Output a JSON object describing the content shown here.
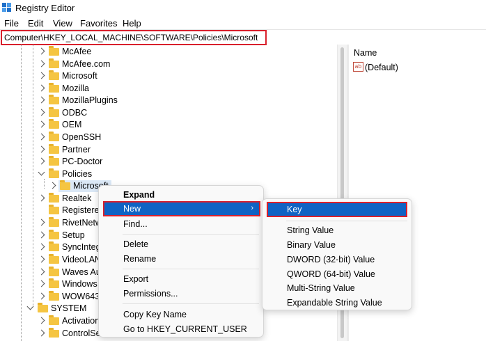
{
  "window": {
    "title": "Registry Editor",
    "icon": "registry-icon"
  },
  "menu": [
    "File",
    "Edit",
    "View",
    "Favorites",
    "Help"
  ],
  "address": {
    "path": "Computer\\HKEY_LOCAL_MACHINE\\SOFTWARE\\Policies\\Microsoft",
    "highlight_color": "#d9202c"
  },
  "tree": {
    "top_items": [
      "McAfee",
      "McAfee.com",
      "Microsoft",
      "Mozilla",
      "MozillaPlugins",
      "ODBC",
      "OEM",
      "OpenSSH",
      "Partner",
      "PC-Doctor"
    ],
    "policies": "Policies",
    "policies_child": "Microsoft",
    "more_items": [
      "Realtek",
      "Registered",
      "RivetNetw",
      "Setup",
      "SyncInteg",
      "VideoLAN",
      "Waves Au",
      "Windows",
      "WOW6432"
    ],
    "system": "SYSTEM",
    "system_children": [
      "Activation",
      "ControlSet"
    ]
  },
  "values": {
    "column_name": "Name",
    "rows": [
      {
        "name": "(Default)",
        "icon": "string-value-icon",
        "icon_text": "ab"
      }
    ]
  },
  "context_menu": {
    "expand": "Expand",
    "new": "New",
    "new_arrow": "›",
    "find": "Find...",
    "delete": "Delete",
    "rename": "Rename",
    "export": "Export",
    "permissions": "Permissions...",
    "copy_key_name": "Copy Key Name",
    "go_to": "Go to HKEY_CURRENT_USER"
  },
  "new_submenu": {
    "key": "Key",
    "string_value": "String Value",
    "binary_value": "Binary Value",
    "dword": "DWORD (32-bit) Value",
    "qword": "QWORD (64-bit) Value",
    "multi_string": "Multi-String Value",
    "expandable": "Expandable String Value"
  },
  "colors": {
    "selection": "#0f63c4",
    "callout": "#d9202c",
    "folder": "#f5c542"
  }
}
